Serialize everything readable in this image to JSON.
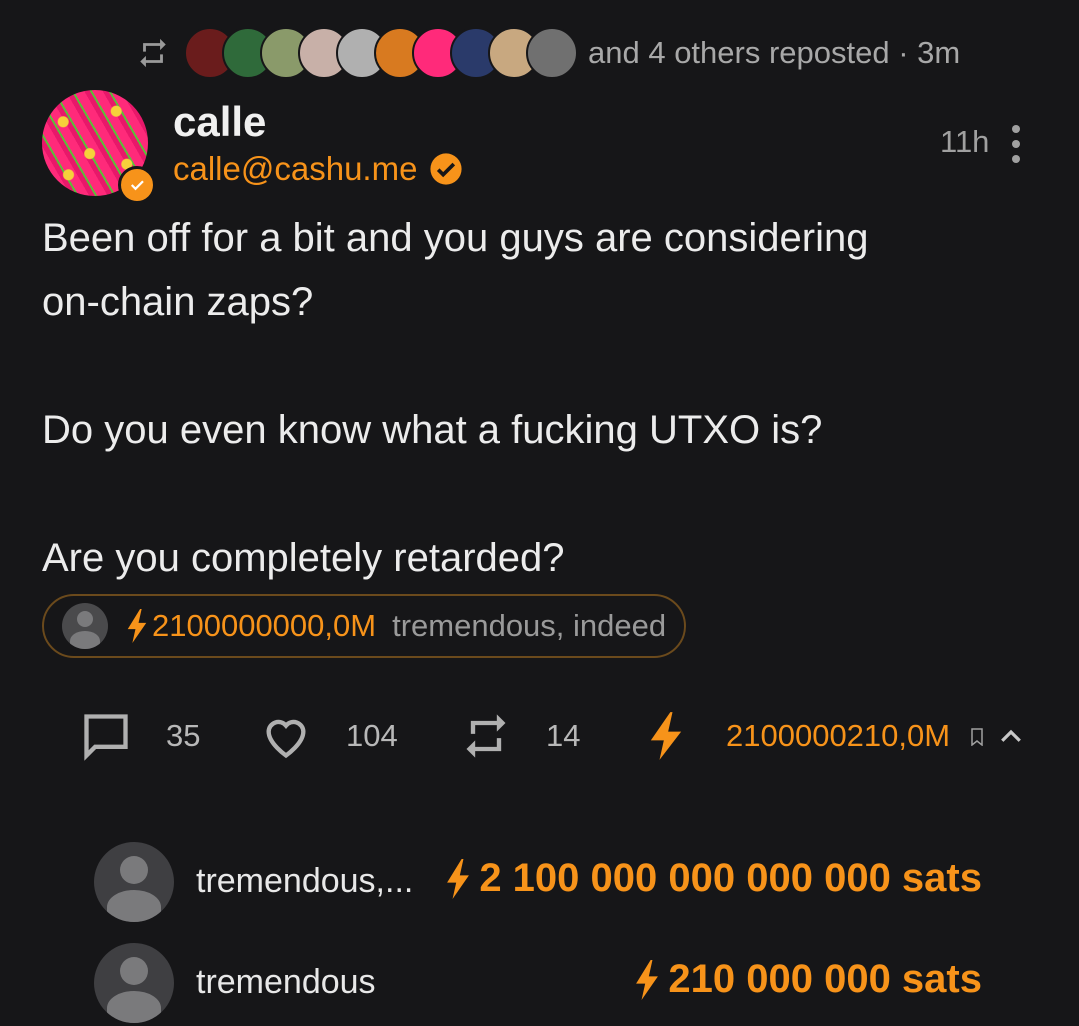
{
  "repost": {
    "text": "and 4 others reposted · 3m",
    "avatars": [
      "#7a2020",
      "#2f6a3a",
      "#8a9a6a",
      "#c8b0a8",
      "#b0b0b0",
      "#d87a20",
      "#ff2a7a",
      "#2a3a6a",
      "#c8a880",
      "#707070"
    ]
  },
  "post": {
    "author_name": "calle",
    "nip05": "calle@cashu.me",
    "time": "11h",
    "body": {
      "line1": "Been off for a bit and you guys are considering",
      "line2": "on-chain zaps?",
      "line3": "Do you even know what a fucking UTXO is?",
      "line4": "Are you completely retarded?"
    }
  },
  "top_zap": {
    "amount": "2100000000,0M",
    "comment": "tremendous, indeed"
  },
  "actions": {
    "replies": "35",
    "likes": "104",
    "reposts": "14",
    "zaps": "2100000210,0M"
  },
  "zaps": [
    {
      "name": "tremendous,...",
      "amount": "2 100 000 000 000 000 sats"
    },
    {
      "name": "tremendous",
      "amount": "210 000 000 sats"
    }
  ],
  "colors": {
    "accent": "#f7931a",
    "background": "#161618"
  }
}
